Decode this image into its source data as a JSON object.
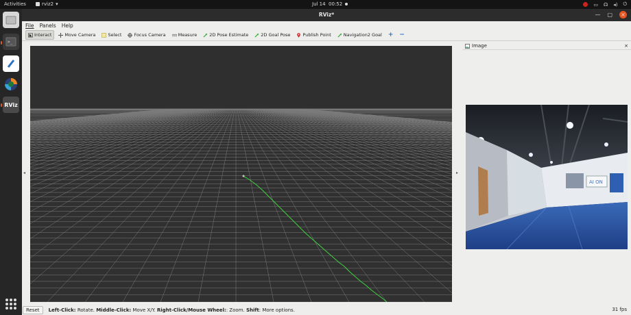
{
  "topbar": {
    "activities": "Activities",
    "app_name": "rviz2",
    "date": "Jul 14",
    "time": "00:52"
  },
  "dock": {
    "items": [
      "files-icon",
      "terminal-icon",
      "text-editor-icon",
      "browser-icon",
      "rviz-icon"
    ],
    "rviz_label": "RViz"
  },
  "window": {
    "title": "RViz*"
  },
  "menu": {
    "file": "File",
    "panels": "Panels",
    "help": "Help"
  },
  "toolbar": {
    "interact": "Interact",
    "move_camera": "Move Camera",
    "select": "Select",
    "focus_camera": "Focus Camera",
    "measure": "Measure",
    "pose_estimate": "2D Pose Estimate",
    "goal_pose": "2D Goal Pose",
    "publish_point": "Publish Point",
    "nav2_goal": "Navigation2 Goal",
    "add_tool": "+",
    "remove_tool": "−"
  },
  "image_panel": {
    "title": "Image"
  },
  "statusbar": {
    "reset": "Reset",
    "hint_left_bold": "Left-Click:",
    "hint_left": " Rotate. ",
    "hint_middle_bold": "Middle-Click:",
    "hint_middle": " Move X/Y. ",
    "hint_right_bold": "Right-Click/Mouse Wheel:",
    "hint_right": ": Zoom. ",
    "hint_shift_bold": "Shift",
    "hint_shift": ": More options.",
    "fps": "31 fps"
  },
  "colors": {
    "accent": "#e95420",
    "path": "#3fd43f",
    "grid": "#8a8a8a",
    "viewport_bg": "#303030"
  }
}
